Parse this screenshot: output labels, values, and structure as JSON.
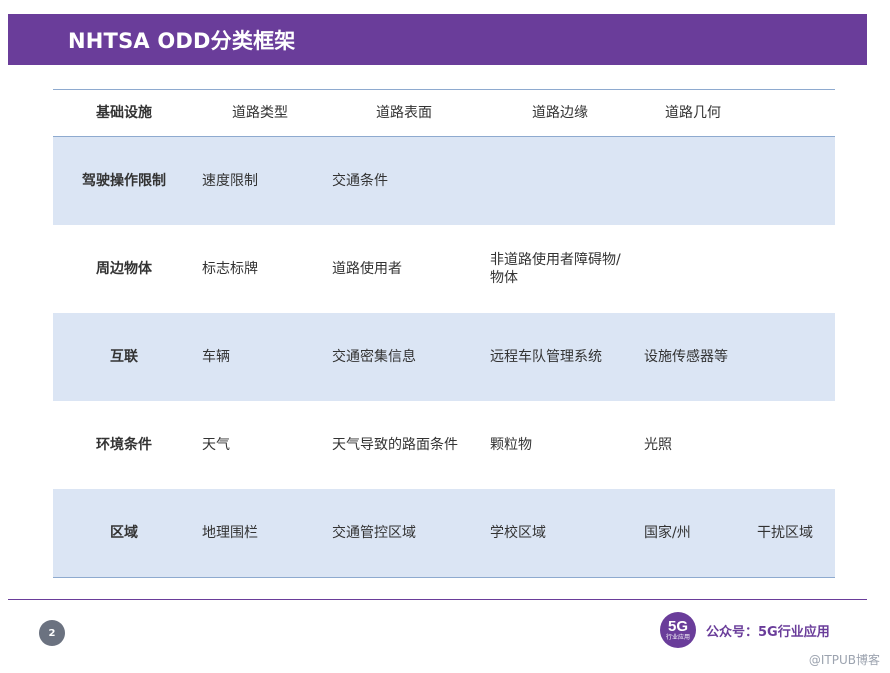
{
  "banner": {
    "title": "NHTSA ODD分类框架",
    "color": "#6a3d9a"
  },
  "table": {
    "header": {
      "category": "基础设施",
      "cells": [
        "道路类型",
        "道路表面",
        "道路边缘",
        "道路几何"
      ]
    },
    "rows": [
      {
        "category": "驾驶操作限制",
        "cells": [
          "速度限制",
          "交通条件"
        ]
      },
      {
        "category": "周边物体",
        "cells": [
          "标志标牌",
          "道路使用者",
          "非道路使用者障碍物/物体"
        ]
      },
      {
        "category": "互联",
        "cells": [
          "车辆",
          "交通密集信息",
          "远程车队管理系统",
          "设施传感器等"
        ]
      },
      {
        "category": "环境条件",
        "cells": [
          "天气",
          "天气导致的路面条件",
          "颗粒物",
          "光照"
        ]
      },
      {
        "category": "区域",
        "cells": [
          "地理围栏",
          "交通管控区域",
          "学校区域",
          "国家/州",
          "干扰区域"
        ]
      }
    ],
    "shade_color": "#dbe5f4",
    "rule_color": "#8eaacf"
  },
  "footer": {
    "page_number": "2",
    "logo_main": "5G",
    "logo_sub": "行业应用",
    "wechat_label": "公众号：5G行业应用",
    "watermark": "@ITPUB博客"
  }
}
